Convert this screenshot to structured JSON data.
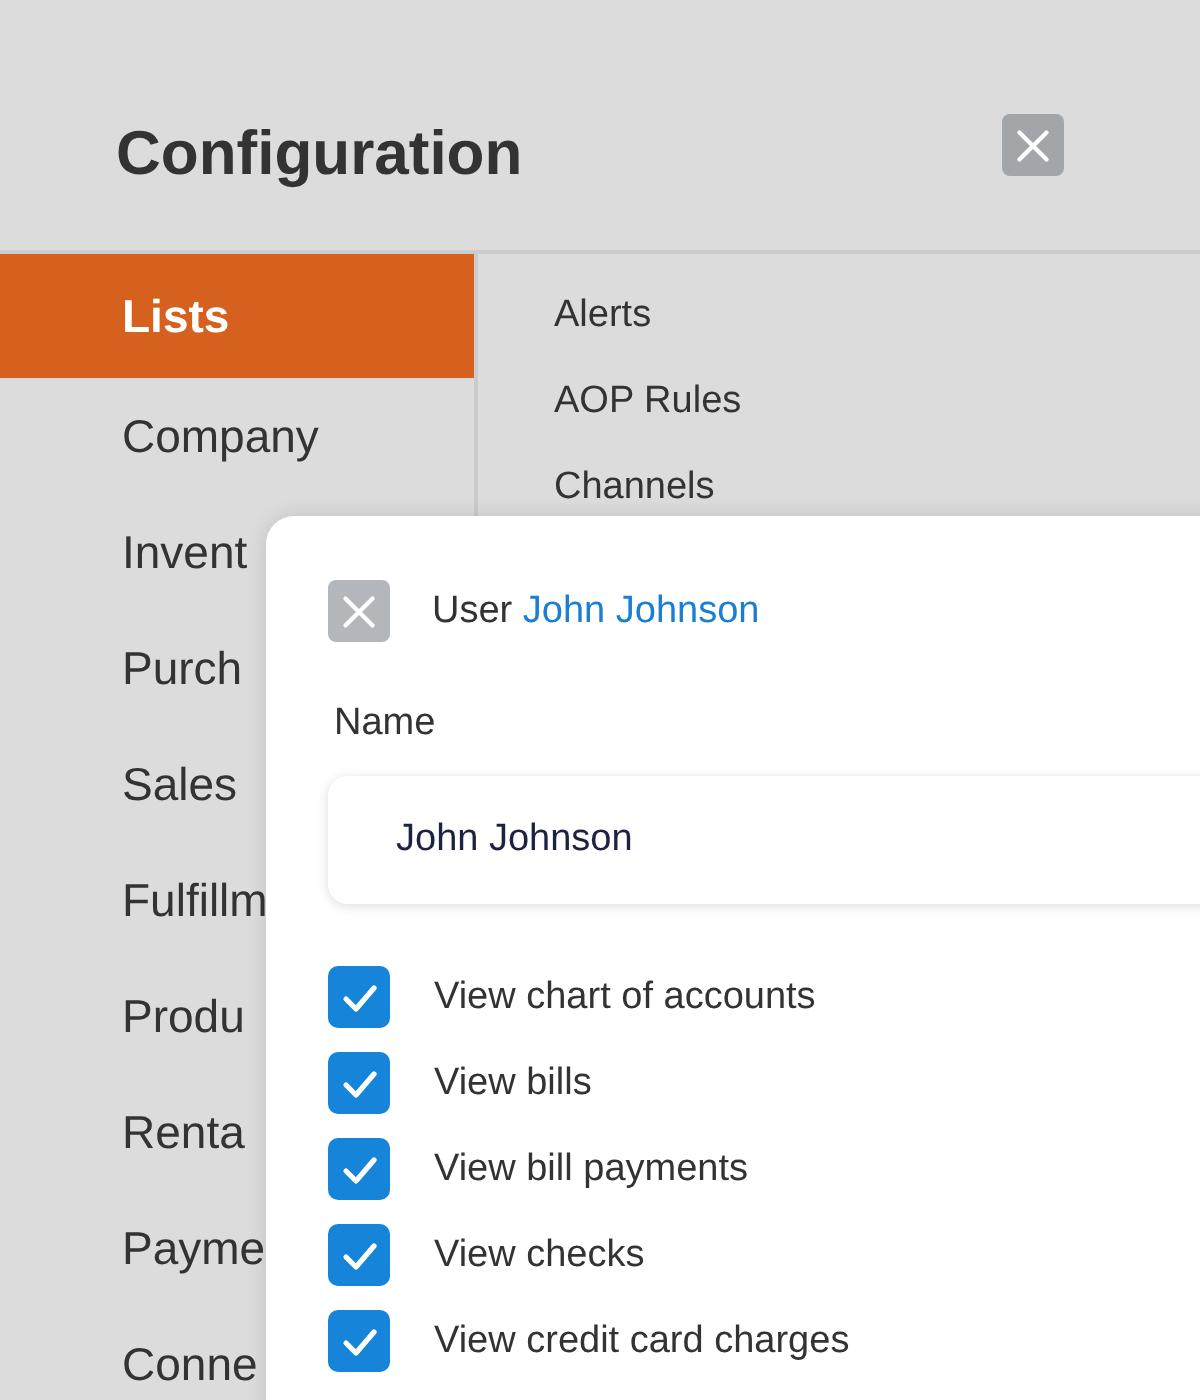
{
  "window": {
    "title": "Configuration"
  },
  "sidebar": {
    "items": [
      {
        "label": "Lists",
        "selected": true
      },
      {
        "label": "Company",
        "selected": false
      },
      {
        "label": "Invent",
        "selected": false
      },
      {
        "label": "Purch",
        "selected": false
      },
      {
        "label": "Sales",
        "selected": false
      },
      {
        "label": "Fulfillm",
        "selected": false
      },
      {
        "label": "Produ",
        "selected": false
      },
      {
        "label": "Renta",
        "selected": false
      },
      {
        "label": "Payme",
        "selected": false
      },
      {
        "label": "Conne",
        "selected": false
      }
    ]
  },
  "lists": [
    "Alerts",
    "AOP Rules",
    "Channels"
  ],
  "user_panel": {
    "title": "User",
    "user_link": "John Johnson",
    "name_label": "Name",
    "name_value": "John Johnson",
    "permissions": [
      {
        "label": "View chart of accounts",
        "checked": true
      },
      {
        "label": "View bills",
        "checked": true
      },
      {
        "label": "View bill payments",
        "checked": true
      },
      {
        "label": "View checks",
        "checked": true
      },
      {
        "label": "View credit card charges",
        "checked": true
      }
    ]
  }
}
